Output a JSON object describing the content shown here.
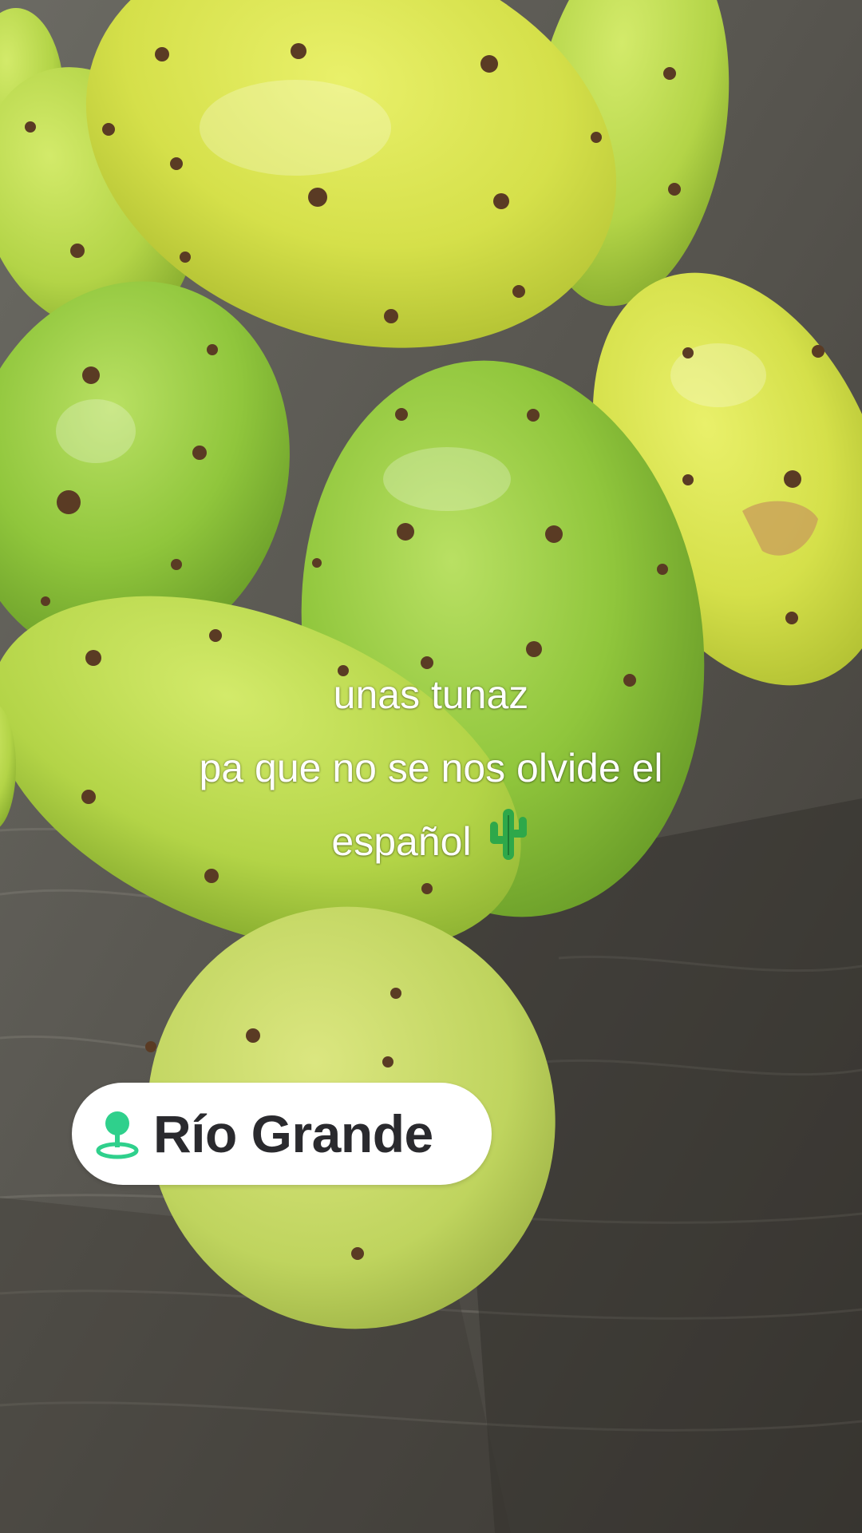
{
  "caption": {
    "line1": "unas tunaz",
    "line2": "pa que no se nos olvide el",
    "line3": "español"
  },
  "caption_emoji": "cactus-icon",
  "location_sticker": {
    "label": "Río Grande",
    "icon": "location-pin-icon",
    "icon_color": "#2fd08c"
  },
  "photo": {
    "subject": "prickly-pear-fruits-icon"
  }
}
